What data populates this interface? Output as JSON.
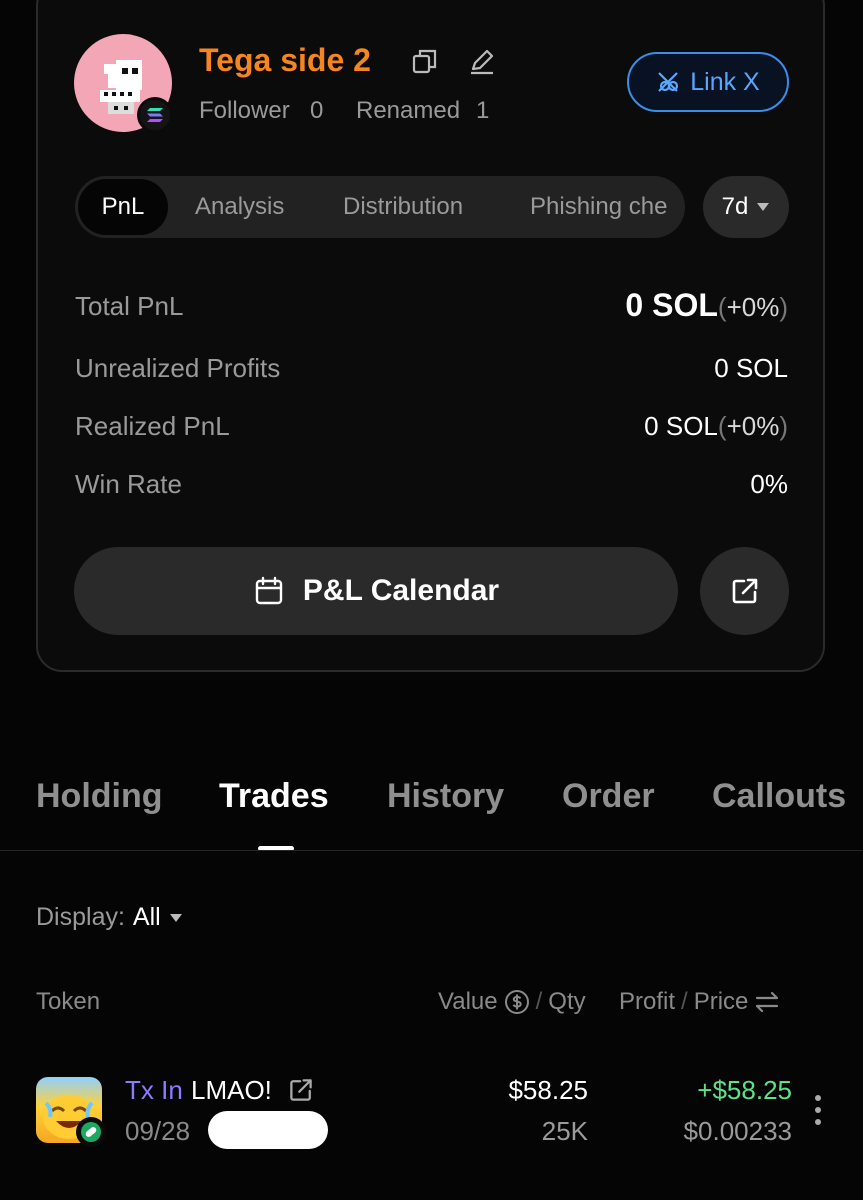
{
  "profile": {
    "name": "Tega side 2",
    "follower_label": "Follower",
    "follower_count": "0",
    "renamed_label": "Renamed",
    "renamed_count": "1",
    "link_x_label": "Link X"
  },
  "analysis_tabs": [
    "PnL",
    "Analysis",
    "Distribution",
    "Phishing che"
  ],
  "period": "7d",
  "stats": {
    "total_pnl_label": "Total PnL",
    "total_pnl_value": "0 SOL",
    "total_pnl_pct": "+0%",
    "unrealized_label": "Unrealized Profits",
    "unrealized_value": "0 SOL",
    "realized_label": "Realized PnL",
    "realized_value": "0 SOL",
    "realized_pct": "+0%",
    "winrate_label": "Win Rate",
    "winrate_value": "0%"
  },
  "calendar_label": "P&L Calendar",
  "main_tabs": [
    "Holding",
    "Trades",
    "History",
    "Order",
    "Callouts"
  ],
  "active_main_tab": "Trades",
  "display": {
    "label": "Display:",
    "value": "All"
  },
  "columns": {
    "token": "Token",
    "value": "Value",
    "qty": "Qty",
    "profit": "Profit",
    "price": "Price",
    "separator": "/"
  },
  "trades": [
    {
      "type": "Tx In",
      "token": "LMAO!",
      "date": "09/28",
      "value": "$58.25",
      "qty": "25K",
      "profit": "+$58.25",
      "price": "$0.00233"
    }
  ],
  "colors": {
    "name": "#f5851f",
    "link": "#5aa6ff",
    "tx_in": "#8b7cff",
    "profit": "#5ee08a"
  },
  "icons": [
    "copy-icon",
    "edit-icon",
    "x-logo-icon",
    "solana-icon",
    "calendar-icon",
    "external-link-icon",
    "dollar-circle-icon",
    "swap-icon",
    "more-vertical-icon",
    "caret-down-icon"
  ]
}
